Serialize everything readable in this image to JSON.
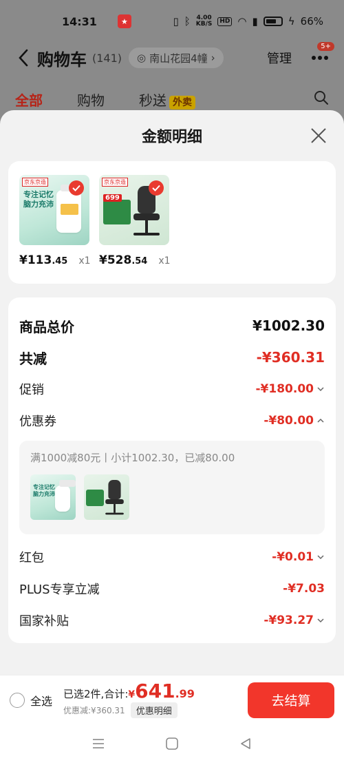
{
  "status_bar": {
    "time": "14:31",
    "net_speed": "4.00",
    "net_unit": "KB/S",
    "hd": "HD",
    "battery": "66%"
  },
  "cart_header": {
    "title": "购物车",
    "count": "(141)",
    "address": "南山花园4幢",
    "manage": "管理",
    "badge": "5+"
  },
  "tabs": [
    {
      "label": "全部"
    },
    {
      "label": "购物"
    },
    {
      "label": "秒送"
    }
  ],
  "tab_tag": "外卖",
  "sheet": {
    "title": "金额明细",
    "goods": [
      {
        "price_int": "¥113",
        "price_dec": ".45",
        "qty": "x1",
        "brand": "京东京造",
        "thumb_text": "专注记忆\n脑力充沛"
      },
      {
        "price_int": "¥528",
        "price_dec": ".54",
        "qty": "x1",
        "brand": "京东京造",
        "promo_price": "699"
      }
    ],
    "rows": {
      "total": {
        "label": "商品总价",
        "value": "¥1002.30"
      },
      "reduce": {
        "label": "共减",
        "value": "-¥360.31"
      },
      "promo": {
        "label": "促销",
        "value": "-¥180.00"
      },
      "coupon": {
        "label": "优惠券",
        "value": "-¥80.00"
      },
      "redpacket": {
        "label": "红包",
        "value": "-¥0.01"
      },
      "plus": {
        "label": "PLUS专享立减",
        "value": "-¥7.03"
      },
      "subsidy": {
        "label": "国家补贴",
        "value": "-¥93.27"
      }
    },
    "coupon_detail": "满1000减80元丨小计1002.30，已减80.00"
  },
  "bottom_bar": {
    "select_all": "全选",
    "summary": "已选2件,合计:",
    "currency": "¥",
    "total_int": "641",
    "total_dec": ".99",
    "discount": "优惠减:¥360.31",
    "detail_button": "优惠明细",
    "checkout": "去结算"
  },
  "colors": {
    "accent_red": "#e02e24",
    "checkout_bg": "#f2362b"
  }
}
